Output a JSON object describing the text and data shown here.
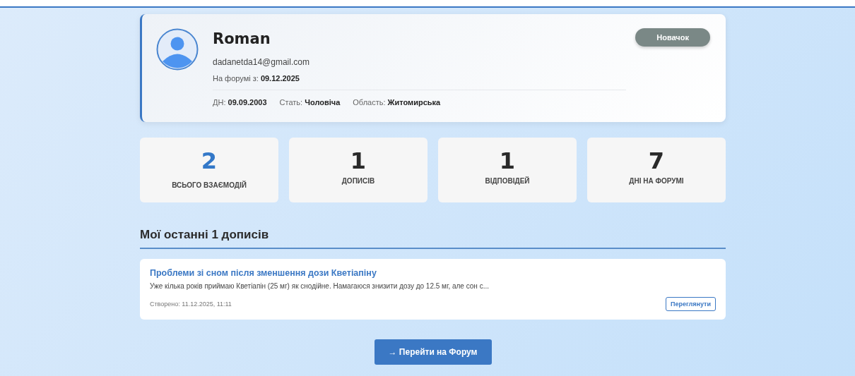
{
  "profile": {
    "name": "Roman",
    "email": "dadanetda14@gmail.com",
    "joined": "На форумі з: **09.12.2025**",
    "badge": "Новачок",
    "details": [
      "ДН: **09.09.2003**",
      "Стать: **Чоловіча**",
      "Область: **Житомирська**"
    ]
  },
  "stats": [
    {
      "value": "2",
      "label": "ВСЬОГО ВЗАЄМОДІЙ",
      "accent": true
    },
    {
      "value": "1",
      "label": "ДОПИСІВ",
      "accent": false
    },
    {
      "value": "1",
      "label": "ВІДПОВІДЕЙ",
      "accent": false
    },
    {
      "value": "7",
      "label": "ДНІ НА ФОРУМІ",
      "accent": false
    }
  ],
  "section_title": "Мої останні 1 дописів",
  "posts": [
    {
      "title": "Проблеми зі сном після зменшення дози Кветіапіну",
      "excerpt": "Уже кілька років приймаю Кветіапін (25 мг) як снодійне. Намагаюся знизити дозу до 12.5 мг, але сон с...",
      "created": "Створено: 11.12.2025, 11:11",
      "action": "Переглянути"
    }
  ],
  "forum_button": "→ Перейти на Форум"
}
